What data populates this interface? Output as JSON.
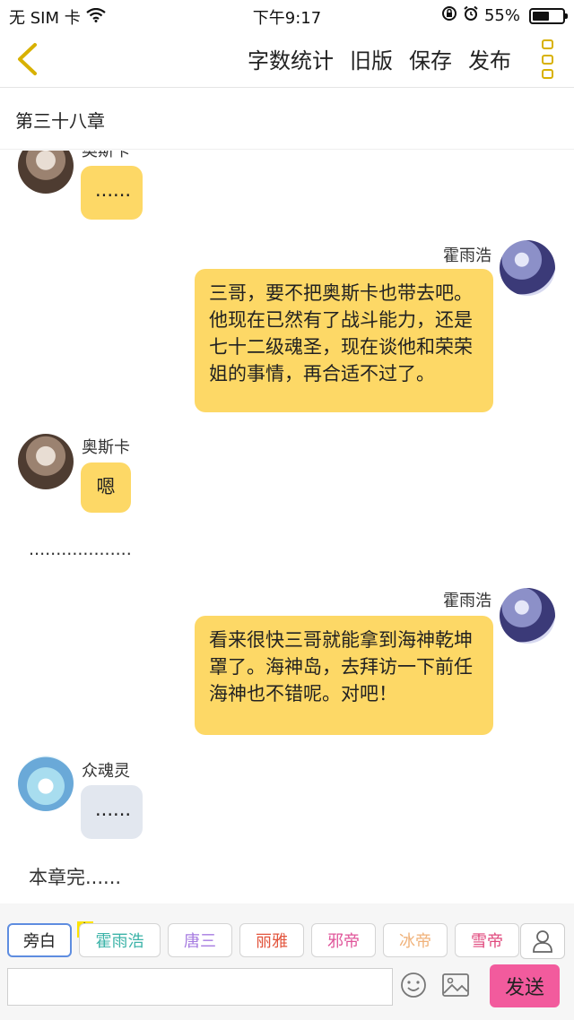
{
  "status_bar": {
    "carrier": "无 SIM 卡",
    "time": "下午9:17",
    "battery": "55%",
    "battery_level": 0.55
  },
  "navbar": {
    "actions": [
      "字数统计",
      "旧版",
      "保存",
      "发布"
    ]
  },
  "chapter": {
    "title": "第三十八章"
  },
  "messages": [
    {
      "sender": "奥斯卡",
      "side": "left",
      "text": "......"
    },
    {
      "sender": "霍雨浩",
      "side": "right",
      "text": "三哥，要不把奥斯卡也带去吧。他现在已然有了战斗能力，还是七十二级魂圣，现在谈他和荣荣姐的事情，再合适不过了。"
    },
    {
      "sender": "奥斯卡",
      "side": "left",
      "text": "嗯"
    },
    {
      "narration": "..................."
    },
    {
      "sender": "霍雨浩",
      "side": "right",
      "text": "看来很快三哥就能拿到海神乾坤罩了。海神岛，去拜访一下前任海神也不错呢。对吧！"
    },
    {
      "sender": "众魂灵",
      "side": "left",
      "text": "......"
    },
    {
      "narration": "本章完......"
    }
  ],
  "role_bar": {
    "roles": [
      {
        "label": "旁白",
        "color": "#222222"
      },
      {
        "label": "霍雨浩",
        "color": "#3bb3a8"
      },
      {
        "label": "唐三",
        "color": "#a67be0"
      },
      {
        "label": "丽雅",
        "color": "#e2553d"
      },
      {
        "label": "邪帝",
        "color": "#e0559a"
      },
      {
        "label": "冰帝",
        "color": "#f0b27a"
      },
      {
        "label": "雪帝",
        "color": "#e04a7e"
      }
    ],
    "lead_badge": "主"
  },
  "input_bar": {
    "placeholder": "",
    "send_label": "发送"
  },
  "colors": {
    "bubble_yellow": "#fdd866",
    "bubble_gray": "#e2e7ef",
    "send_pink": "#f25b9d",
    "accent_gold": "#d8b100"
  }
}
